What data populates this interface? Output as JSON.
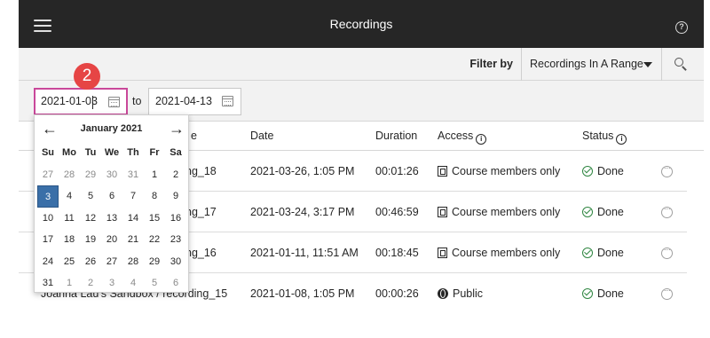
{
  "header": {
    "title": "Recordings"
  },
  "filter": {
    "label": "Filter by",
    "selected": "Recordings In A Range"
  },
  "range": {
    "start": "2021-01-03",
    "to_label": "to",
    "end": "2021-04-13"
  },
  "step_badge": "2",
  "table": {
    "columns": {
      "name": "e",
      "date": "Date",
      "duration": "Duration",
      "access": "Access",
      "status": "Status"
    },
    "rows": [
      {
        "name": "ng_18",
        "date": "2021-03-26, 1:05 PM",
        "duration": "00:01:26",
        "access": "Course members only",
        "status": "Done"
      },
      {
        "name": "ng_17",
        "date": "2021-03-24, 3:17 PM",
        "duration": "00:46:59",
        "access": "Course members only",
        "status": "Done"
      },
      {
        "name": "ng_16",
        "date": "2021-01-11, 11:51 AM",
        "duration": "00:18:45",
        "access": "Course members only",
        "status": "Done"
      },
      {
        "name": "Joanna Lau's Sandbox / recording_15",
        "date": "2021-01-08, 1:05 PM",
        "duration": "00:00:26",
        "access": "Public",
        "status": "Done"
      }
    ]
  },
  "calendar": {
    "month_title": "January 2021",
    "weekdays": [
      "Su",
      "Mo",
      "Tu",
      "We",
      "Th",
      "Fr",
      "Sa"
    ],
    "weeks": [
      [
        "27",
        "28",
        "29",
        "30",
        "31",
        "1",
        "2"
      ],
      [
        "3",
        "4",
        "5",
        "6",
        "7",
        "8",
        "9"
      ],
      [
        "10",
        "11",
        "12",
        "13",
        "14",
        "15",
        "16"
      ],
      [
        "17",
        "18",
        "19",
        "20",
        "21",
        "22",
        "23"
      ],
      [
        "24",
        "25",
        "26",
        "27",
        "28",
        "29",
        "30"
      ],
      [
        "31",
        "1",
        "2",
        "3",
        "4",
        "5",
        "6"
      ]
    ],
    "selected_day": "3"
  },
  "colors": {
    "header_bg": "#262626",
    "active_outline": "#c9489a",
    "selected_day_bg": "#3a6fa8",
    "done_green": "#2e8540",
    "badge_red": "#e64545"
  }
}
